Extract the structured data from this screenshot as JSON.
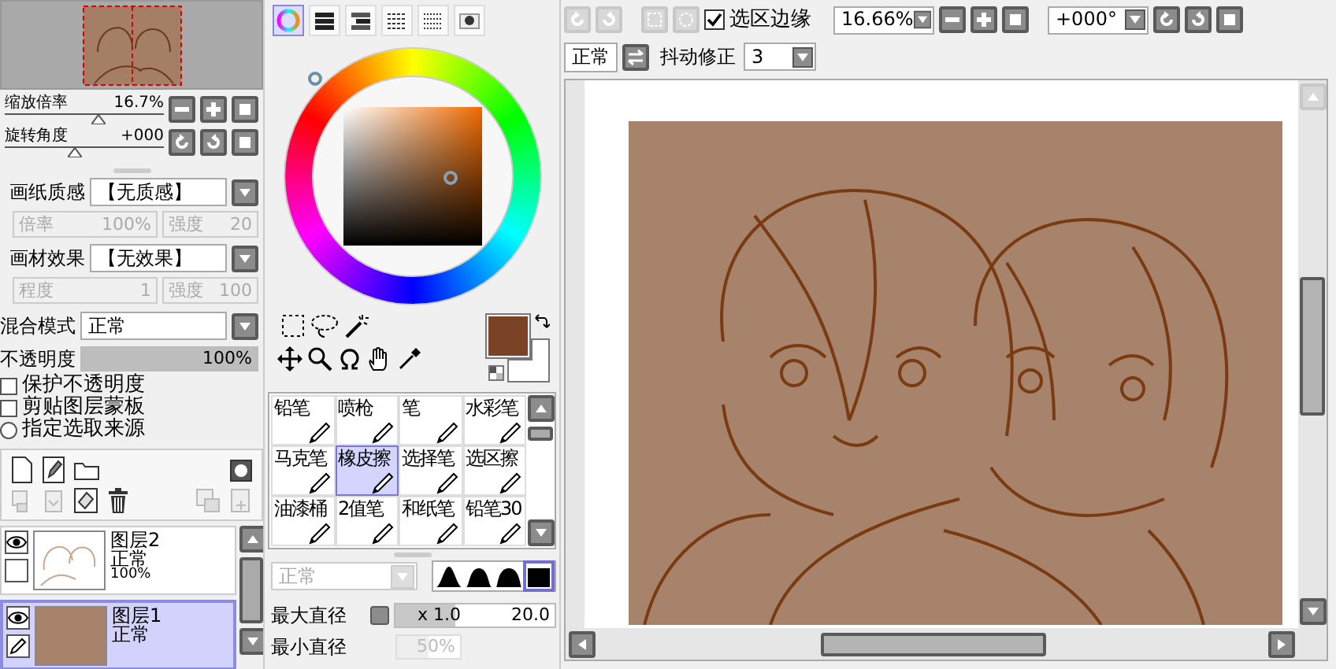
{
  "navigator": {
    "zoom_label": "缩放倍率",
    "zoom_value": "16.7%",
    "rotate_label": "旋转角度",
    "rotate_value": "+000"
  },
  "paper_texture": {
    "label": "画纸质感",
    "value": "【无质感】",
    "scale_label": "倍率",
    "scale_value": "100%",
    "strength_label": "强度",
    "strength_value": "20"
  },
  "brush_effect": {
    "label": "画材效果",
    "value": "【无效果】",
    "degree_label": "程度",
    "degree_value": "1",
    "strength_label": "强度",
    "strength_value": "100"
  },
  "blend_mode": {
    "label": "混合模式",
    "value": "正常"
  },
  "opacity": {
    "label": "不透明度",
    "value": "100%",
    "level": 1
  },
  "layer_options": [
    {
      "kind": "checkbox",
      "label": "保护不透明度",
      "checked": false
    },
    {
      "kind": "checkbox",
      "label": "剪贴图层蒙板",
      "checked": false
    },
    {
      "kind": "radio",
      "label": "指定选取来源",
      "checked": false
    }
  ],
  "layers": [
    {
      "name": "图层2",
      "mode": "正常",
      "opacity": "100%",
      "visible": true,
      "selected": false
    },
    {
      "name": "图层1",
      "mode": "正常",
      "visible": true,
      "selected": true
    }
  ],
  "color_tabs": [
    {
      "selected": true
    },
    {
      "selected": false
    },
    {
      "selected": false
    },
    {
      "selected": false
    },
    {
      "selected": false
    },
    {
      "selected": false
    }
  ],
  "brushes": [
    {
      "label": "铅笔",
      "selected": false
    },
    {
      "label": "喷枪",
      "selected": false
    },
    {
      "label": "笔",
      "selected": false
    },
    {
      "label": "水彩笔",
      "selected": false
    },
    {
      "label": "马克笔",
      "selected": false
    },
    {
      "label": "橡皮擦",
      "selected": true
    },
    {
      "label": "选择笔",
      "selected": false
    },
    {
      "label": "选区擦",
      "selected": false
    },
    {
      "label": "油漆桶",
      "selected": false
    },
    {
      "label": "2值笔",
      "selected": false
    },
    {
      "label": "和纸笔",
      "selected": false
    },
    {
      "label": "铅笔30",
      "selected": false
    }
  ],
  "brush_mode": {
    "value": "正常",
    "disabled": true
  },
  "brush_shapes": [
    {
      "selected": false
    },
    {
      "selected": false
    },
    {
      "selected": false
    },
    {
      "selected": true
    }
  ],
  "max_size": {
    "label": "最大直径",
    "multiplier": "x 1.0",
    "value": "20.0",
    "level": 0.38
  },
  "min_size": {
    "label": "最小直径",
    "value": "50%",
    "level": 0.5
  },
  "toolbar": {
    "selection_edge": {
      "label": "选区边缘",
      "checked": true
    },
    "zoom": "16.66%",
    "angle": "+000°",
    "mode": "正常",
    "stabilizer_label": "抖动修正",
    "stabilizer": "3"
  }
}
